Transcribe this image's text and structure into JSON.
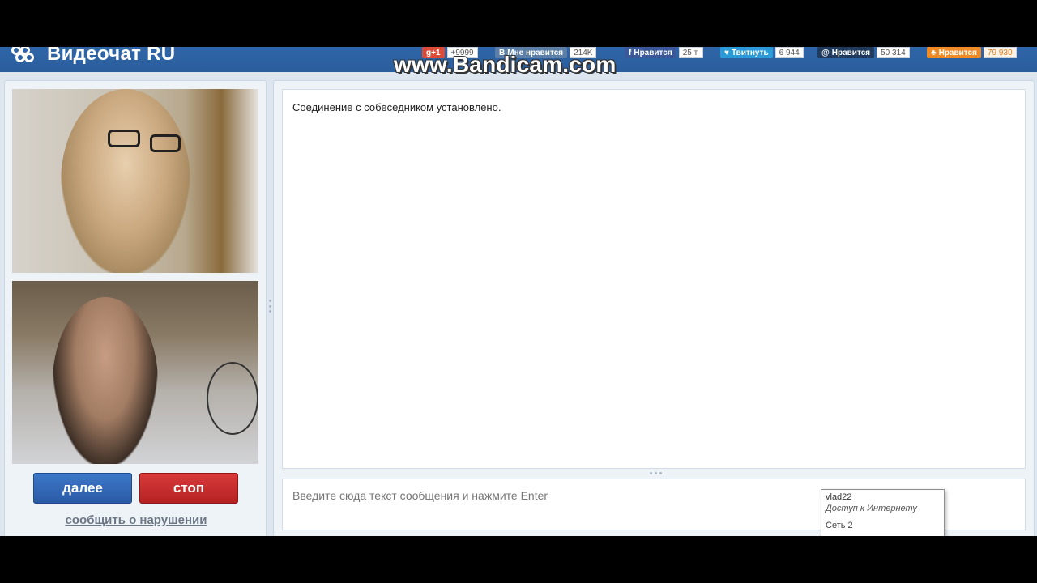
{
  "header": {
    "logo_text": "Видеочат RU",
    "watermark": "www.Bandicam.com",
    "social": [
      {
        "label": "g+1",
        "count": "+9999",
        "color": "#dd4b39"
      },
      {
        "label": "Мне нравится",
        "count": "214K",
        "color": "#5b7fa6"
      },
      {
        "label": "Нравится",
        "count": "25 т.",
        "color": "#3b5998"
      },
      {
        "label": "Твитнуть",
        "count": "6 944",
        "color": "#2a9bd7"
      },
      {
        "label": "Нравится",
        "count": "50 314",
        "color": "#1f3a5c"
      },
      {
        "label": "Нравится",
        "count": "79 930",
        "color": "#f08a24"
      }
    ]
  },
  "left": {
    "next_label": "далее",
    "stop_label": "стоп",
    "report_label": "сообщить о нарушении"
  },
  "chat": {
    "status_message": "Соединение с собеседником установлено.",
    "input_placeholder": "Введите сюда текст сообщения и нажмите Enter"
  },
  "tooltip": {
    "user": "vlad22",
    "access": "Доступ к Интернету",
    "network": "Сеть  2"
  },
  "colors": {
    "header_bg": "#2f66a8",
    "next_button": "#3c78c8",
    "stop_button": "#d83a3a",
    "panel_bg": "#eef3f8"
  }
}
